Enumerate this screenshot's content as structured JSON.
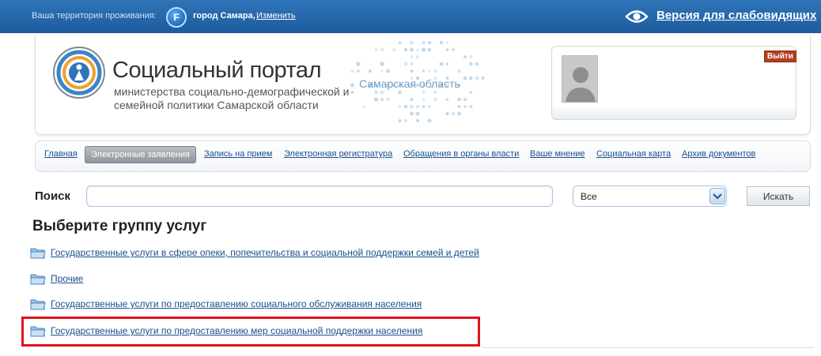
{
  "topbar": {
    "territory_label": "Ваша территория проживания:",
    "city": "город Самара,",
    "change_link": "Изменить",
    "flag_letter": "F",
    "accessible_version": "Версия для слабовидящих"
  },
  "header": {
    "portal_title": "Социальный портал",
    "portal_subtitle": "министерства социально-демографической и семейной политики Самарской области",
    "region_label": "Самарская область"
  },
  "user": {
    "logout_label": "Выйти"
  },
  "nav": {
    "items": [
      {
        "label": "Главная",
        "active": false
      },
      {
        "label": "Электронные заявления",
        "active": true
      },
      {
        "label": "Запись на прием",
        "active": false
      },
      {
        "label": "Электронная регистратура",
        "active": false
      },
      {
        "label": "Обращения в органы власти",
        "active": false
      },
      {
        "label": "Ваше мнение",
        "active": false
      },
      {
        "label": "Социальная карта",
        "active": false
      },
      {
        "label": "Архив документов",
        "active": false
      }
    ]
  },
  "search": {
    "label": "Поиск",
    "value": "",
    "select_value": "Все",
    "button_label": "Искать"
  },
  "services": {
    "title": "Выберите группу услуг",
    "items": [
      "Государственные услуги в сфере опеки, попечительства и социальной поддержки семей и детей",
      "Прочие",
      "Государственные услуги по предоставлению социального обслуживания населения",
      "Государственные услуги по предоставлению мер социальной поддержки населения"
    ],
    "highlighted_index": 3
  },
  "colors": {
    "topbar": "#1d5c9d",
    "link": "#1a4f8b",
    "highlight": "#e1111c",
    "logout": "#b5401f"
  }
}
